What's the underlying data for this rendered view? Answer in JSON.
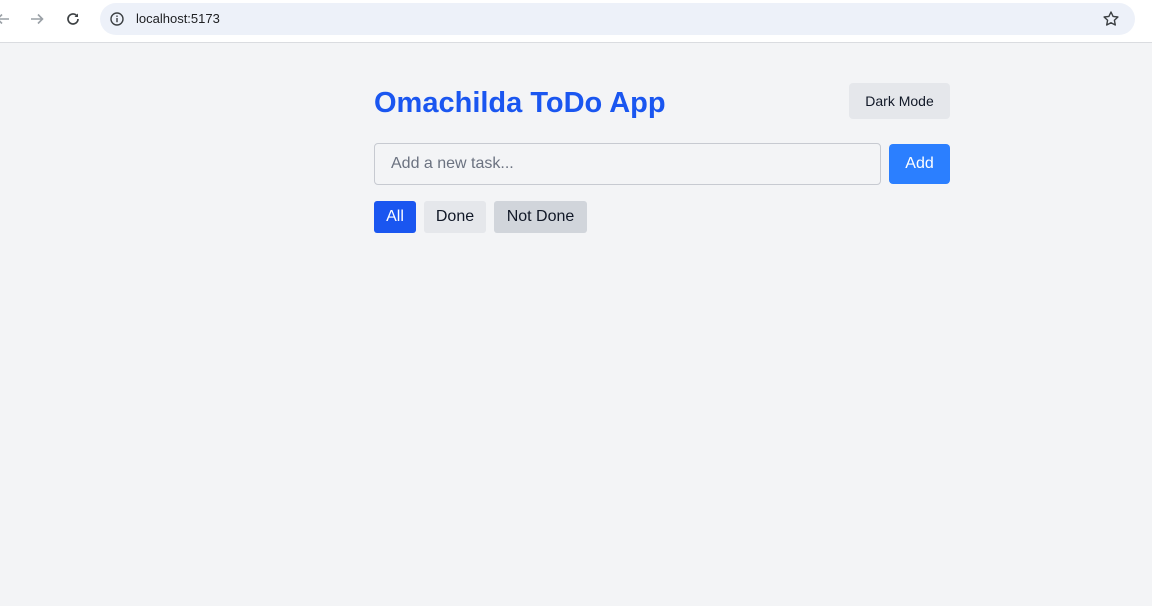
{
  "browser": {
    "url": "localhost:5173",
    "icons": [
      "back-icon",
      "forward-icon",
      "reload-icon",
      "info-icon",
      "bookmark-star-icon"
    ]
  },
  "app": {
    "title": "Omachilda ToDo App",
    "dark_mode_label": "Dark Mode",
    "input_placeholder": "Add a new task...",
    "input_value": "",
    "add_label": "Add",
    "filters": [
      {
        "label": "All",
        "active": true
      },
      {
        "label": "Done",
        "active": false
      },
      {
        "label": "Not Done",
        "active": false
      }
    ]
  },
  "colors": {
    "title": "#1a56f0",
    "active_filter": "#1a56f0",
    "add_button": "#2b7fff",
    "page_background": "#f3f4f6"
  }
}
